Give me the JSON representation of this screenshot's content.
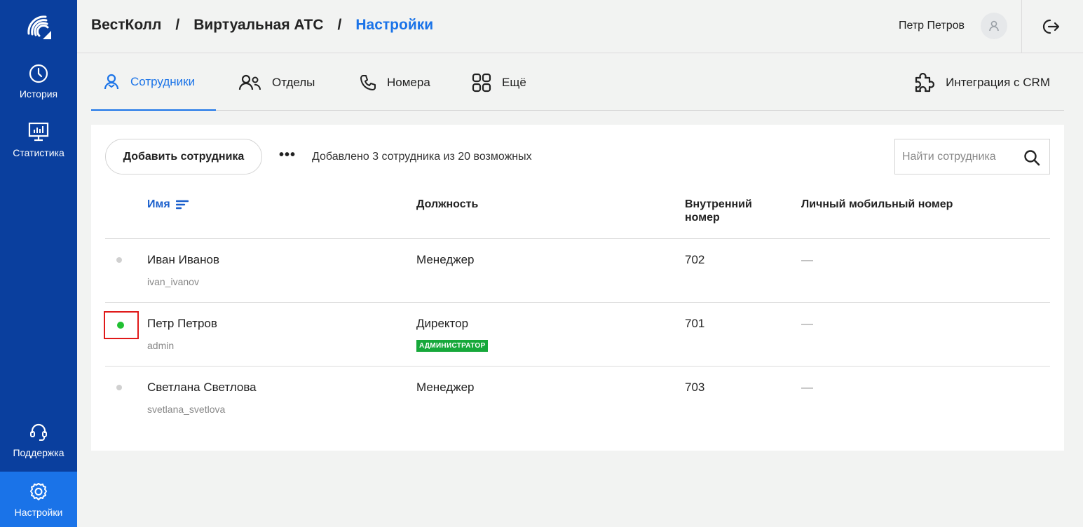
{
  "sidebar": {
    "items": [
      {
        "label": "История",
        "icon": "clock-icon"
      },
      {
        "label": "Статистика",
        "icon": "chart-monitor-icon"
      },
      {
        "label": "Поддержка",
        "icon": "headset-icon"
      },
      {
        "label": "Настройки",
        "icon": "gear-icon",
        "active": true
      }
    ]
  },
  "header": {
    "breadcrumb": [
      "ВестКолл",
      "Виртуальная АТС",
      "Настройки"
    ],
    "separator": "/",
    "user_name": "Петр Петров"
  },
  "tabs": [
    {
      "label": "Сотрудники",
      "icon": "user-icon",
      "active": true
    },
    {
      "label": "Отделы",
      "icon": "users-icon"
    },
    {
      "label": "Номера",
      "icon": "phone-icon"
    },
    {
      "label": "Ещё",
      "icon": "grid-icon"
    }
  ],
  "crm": {
    "label": "Интеграция с CRM",
    "icon": "puzzle-icon"
  },
  "toolbar": {
    "add_label": "Добавить сотрудника",
    "more_label": "•••",
    "count_text": "Добавлено 3 сотрудника из 20 возможных",
    "search_placeholder": "Найти сотрудника"
  },
  "table": {
    "headers": {
      "name": "Имя",
      "position": "Должность",
      "ext_line1": "Внутренний",
      "ext_line2": "номер",
      "mobile": "Личный мобильный номер"
    },
    "rows": [
      {
        "name": "Иван Иванов",
        "login": "ivan_ivanov",
        "position": "Менеджер",
        "ext": "702",
        "mobile": "—",
        "status": "offline"
      },
      {
        "name": "Петр Петров",
        "login": "admin",
        "position": "Директор",
        "badge": "АДМИНИСТРАТОР",
        "ext": "701",
        "mobile": "—",
        "status": "online"
      },
      {
        "name": "Светлана Светлова",
        "login": "svetlana_svetlova",
        "position": "Менеджер",
        "ext": "703",
        "mobile": "—",
        "status": "offline"
      }
    ]
  },
  "colors": {
    "sidebar": "#0a3f9e",
    "accent": "#1a73e8",
    "online": "#21c032",
    "badge": "#16a83a",
    "highlight": "#e01919"
  }
}
